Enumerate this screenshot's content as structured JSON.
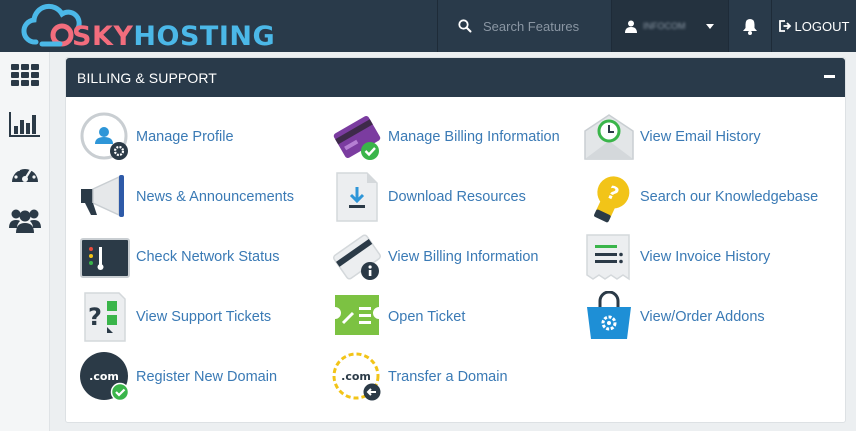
{
  "header": {
    "logo_sky": "SKY",
    "logo_hosting": "HOSTING",
    "search_placeholder": "Search Features",
    "username": "INFOCOM",
    "logout_label": "LOGOUT"
  },
  "sidebar": {
    "items": [
      {
        "name": "dashboard",
        "icon": "grid-icon"
      },
      {
        "name": "stats",
        "icon": "bar-chart-icon"
      },
      {
        "name": "performance",
        "icon": "speedometer-icon"
      },
      {
        "name": "users",
        "icon": "users-icon"
      }
    ]
  },
  "panel": {
    "title": "BILLING & SUPPORT",
    "items": [
      {
        "label": "Manage Profile",
        "icon": "profile-settings-icon"
      },
      {
        "label": "Manage Billing Information",
        "icon": "credit-card-check-icon"
      },
      {
        "label": "View Email History",
        "icon": "email-clock-icon"
      },
      {
        "label": "News & Announcements",
        "icon": "megaphone-icon"
      },
      {
        "label": "Download Resources",
        "icon": "download-file-icon"
      },
      {
        "label": "Search our Knowledgebase",
        "icon": "lightbulb-question-icon"
      },
      {
        "label": "Check Network Status",
        "icon": "network-status-icon"
      },
      {
        "label": "View Billing Information",
        "icon": "credit-card-info-icon"
      },
      {
        "label": "View Invoice History",
        "icon": "invoice-icon"
      },
      {
        "label": "View Support Tickets",
        "icon": "support-tickets-icon"
      },
      {
        "label": "Open Ticket",
        "icon": "ticket-edit-icon"
      },
      {
        "label": "View/Order Addons",
        "icon": "shopping-bag-gear-icon"
      },
      {
        "label": "Register New Domain",
        "icon": "domain-check-icon"
      },
      {
        "label": "Transfer a Domain",
        "icon": "domain-transfer-icon"
      }
    ]
  },
  "colors": {
    "header_bg": "#293a4a",
    "link": "#3a7ab5",
    "logo_pink": "#f26d7d",
    "logo_blue": "#4bb8e8"
  }
}
